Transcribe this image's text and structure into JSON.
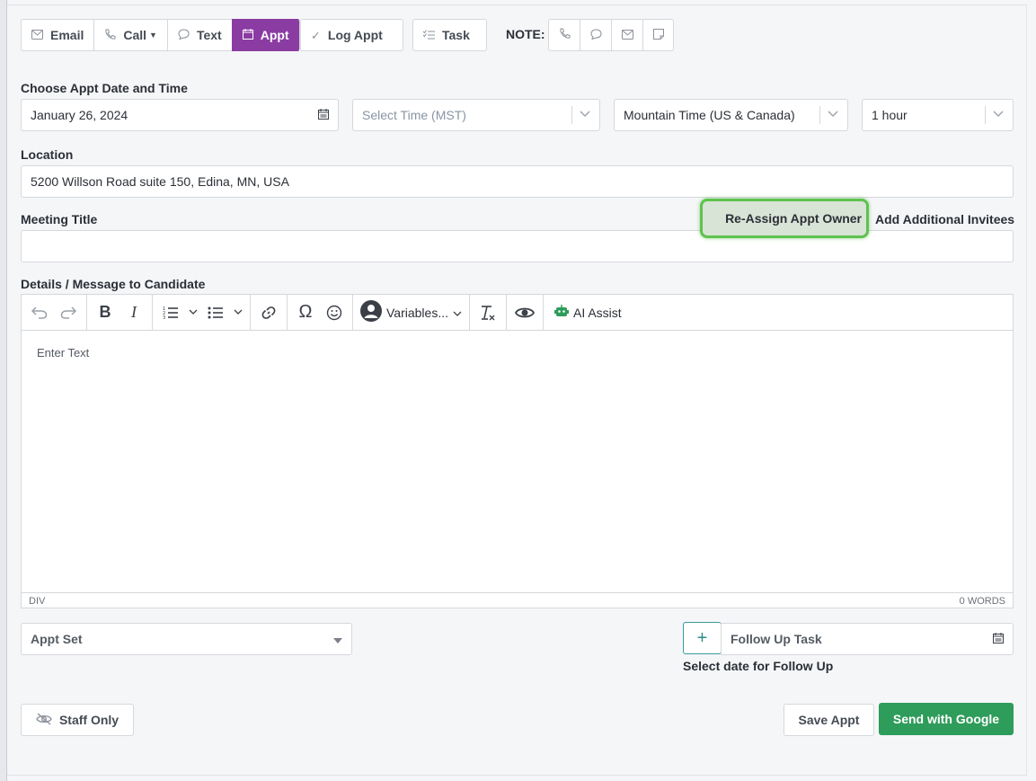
{
  "actions": {
    "email": "Email",
    "call": "Call",
    "text": "Text",
    "appt": "Appt",
    "log_appt": "Log Appt",
    "task": "Task",
    "note_label": "NOTE:"
  },
  "form": {
    "date_label": "Choose Appt Date and Time",
    "date_value": "January 26, 2024",
    "time_placeholder": "Select Time (MST)",
    "timezone_value": "Mountain Time (US & Canada)",
    "duration_value": "1 hour",
    "location_label": "Location",
    "location_value": "5200 Willson Road suite 150, Edina, MN, USA",
    "meeting_title_label": "Meeting Title",
    "meeting_title_value": "",
    "reassign_label": "Re-Assign Appt Owner",
    "add_invitees_label": "Add Additional Invitees",
    "details_label": "Details / Message to Candidate"
  },
  "editor": {
    "variables_label": "Variables...",
    "ai_assist_label": "AI Assist",
    "placeholder": "Enter Text",
    "status_path": "DIV",
    "word_count": "0 WORDS"
  },
  "footer": {
    "status_select": "Appt Set",
    "follow_up_placeholder": "Follow Up Task",
    "follow_up_hint": "Select date for Follow Up",
    "staff_only": "Staff Only",
    "save_appt": "Save Appt",
    "send_google": "Send with Google"
  },
  "colors": {
    "active_tab": "#8b3ca3",
    "send_button": "#2e9c5a",
    "highlight": "#5ec24e"
  }
}
